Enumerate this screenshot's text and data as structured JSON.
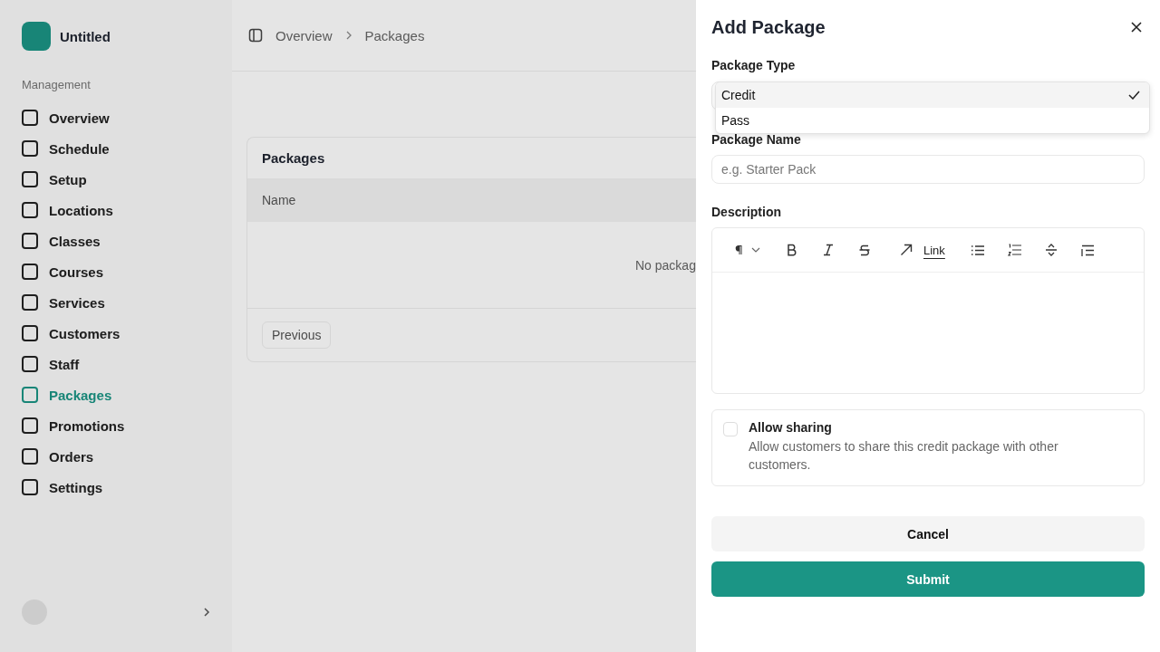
{
  "app": {
    "name": "Untitled"
  },
  "sidebar": {
    "section": "Management",
    "items": [
      {
        "label": "Overview",
        "selected": false
      },
      {
        "label": "Schedule",
        "selected": false
      },
      {
        "label": "Setup",
        "selected": false
      },
      {
        "label": "Locations",
        "selected": false
      },
      {
        "label": "Classes",
        "selected": false
      },
      {
        "label": "Courses",
        "selected": false
      },
      {
        "label": "Services",
        "selected": false
      },
      {
        "label": "Customers",
        "selected": false
      },
      {
        "label": "Staff",
        "selected": false
      },
      {
        "label": "Packages",
        "selected": true
      },
      {
        "label": "Promotions",
        "selected": false
      },
      {
        "label": "Orders",
        "selected": false
      },
      {
        "label": "Settings",
        "selected": false
      }
    ]
  },
  "breadcrumb": [
    "Overview",
    "Packages"
  ],
  "card": {
    "title": "Packages",
    "column": "Name",
    "empty_text": "No packag",
    "pager_button": "Previous"
  },
  "drawer": {
    "title": "Add Package",
    "type_label": "Package Type",
    "type_options": [
      {
        "label": "Credit",
        "selected": true
      },
      {
        "label": "Pass",
        "selected": false
      }
    ],
    "name_label": "Package Name",
    "name_placeholder": "e.g. Starter Pack",
    "description_label": "Description",
    "toolbar": [
      {
        "kind": "paragraph"
      },
      {
        "kind": "bold"
      },
      {
        "kind": "italic"
      },
      {
        "kind": "strike"
      },
      {
        "kind": "arrow"
      },
      {
        "kind": "link",
        "label": "Link"
      },
      {
        "kind": "bullets"
      },
      {
        "kind": "numbers"
      },
      {
        "kind": "divider"
      },
      {
        "kind": "indent"
      }
    ],
    "sharing": {
      "title": "Allow sharing",
      "text": "Allow customers to share this credit package with other customers.",
      "checked": false
    },
    "buttons": [
      {
        "label": "Cancel",
        "kind": "secondary"
      },
      {
        "label": "Submit",
        "kind": "primary"
      }
    ]
  }
}
